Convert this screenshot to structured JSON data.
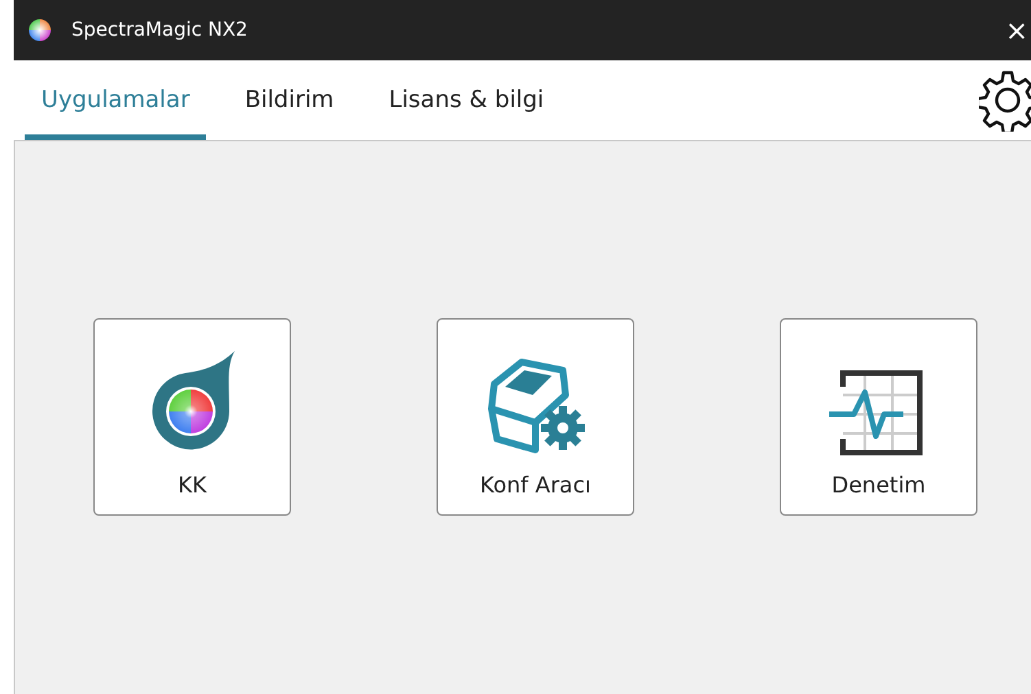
{
  "window": {
    "title": "SpectraMagic NX2",
    "close": "×"
  },
  "tabs": [
    {
      "label": "Uygulamalar",
      "selected": true
    },
    {
      "label": "Bildirim",
      "selected": false
    },
    {
      "label": "Lisans & bilgi",
      "selected": false
    }
  ],
  "apps": [
    {
      "label": "KK",
      "kind": "drop"
    },
    {
      "label": "Konf Aracı",
      "kind": "device"
    },
    {
      "label": "Denetim",
      "kind": "chart"
    }
  ]
}
